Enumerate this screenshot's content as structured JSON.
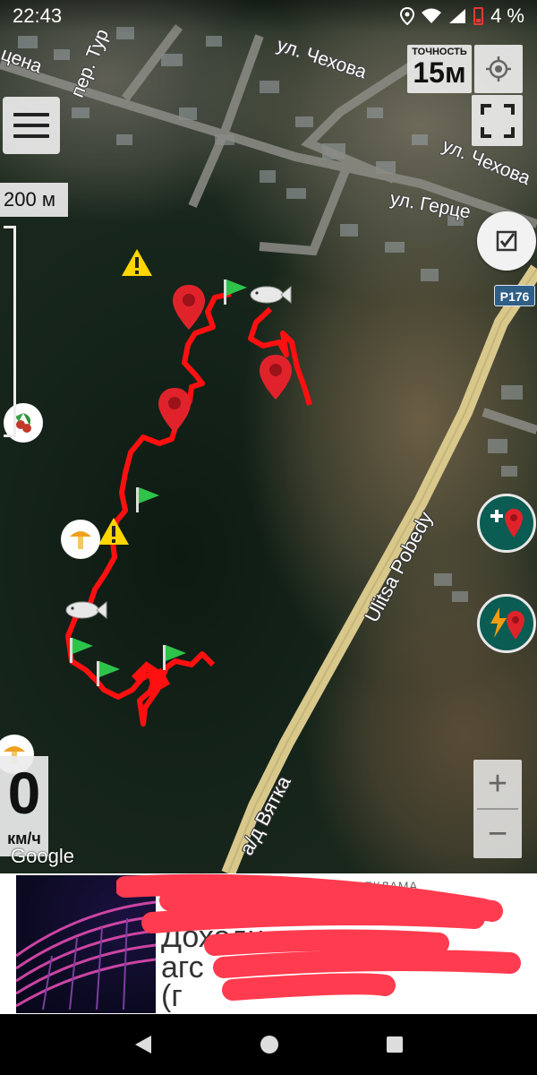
{
  "status_bar": {
    "time": "22:43",
    "battery_text": "4 %",
    "icons": [
      "location-icon",
      "wifi-icon",
      "signal-icon",
      "battery-icon"
    ]
  },
  "map": {
    "street_labels": [
      "ул. Чехова",
      "ул. Чехова",
      "ул. Герце",
      "цена",
      "пер. Тур"
    ],
    "highway_labels": [
      "Ulitsa Pobedy",
      "а/д Вятка"
    ],
    "route_shield": "Р176",
    "attribution": "Google"
  },
  "controls": {
    "accuracy_label": "ТОЧНОСТЬ",
    "accuracy_value": "15м",
    "scale_label": "200 м",
    "speed_value": "0",
    "speed_unit": "км/ч",
    "zoom_in": "+",
    "zoom_out": "−"
  },
  "ad": {
    "label": "РЕКЛАМА",
    "headline": "Доходн",
    "subline_1": "агс",
    "subline_2": "(г"
  },
  "colors": {
    "track": "#ff1010",
    "pin": "#e0232b",
    "flag": "#2ec44a",
    "warning": "#ffd600",
    "round_button": "#0b5c52",
    "scribble": "#ff3b4f"
  }
}
